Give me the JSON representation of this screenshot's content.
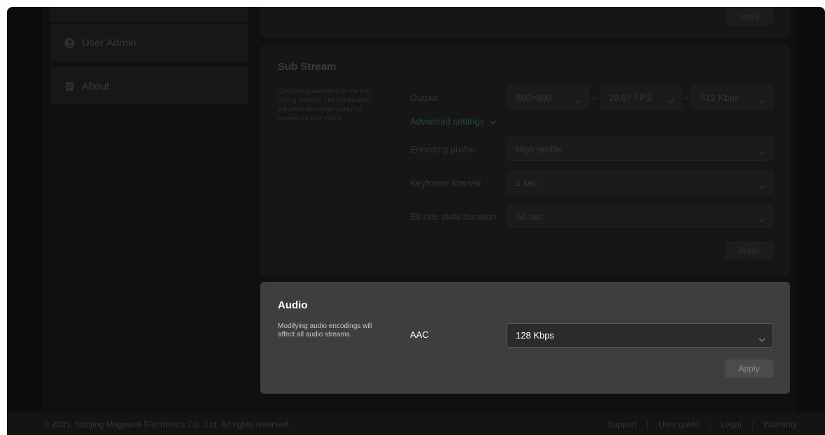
{
  "sidebar": {
    "items": [
      {
        "label": "User Admin",
        "icon": "user-circle-icon"
      },
      {
        "label": "About",
        "icon": "document-icon"
      }
    ]
  },
  "top_panel": {
    "apply_label": "Apply"
  },
  "sub_stream": {
    "title": "Sub Stream",
    "description": "Configure parameters for the sub coding streams. The modification will affect the image quality for preview on your phone.",
    "output_label": "Output",
    "resolution": "800×600",
    "frame_rate": "29.97 FPS",
    "bitrate": "512 Kbps",
    "advanced_settings": "Advanced settings",
    "encoding_profile_label": "Encoding profile",
    "encoding_profile_value": "High profile",
    "keyframe_interval_label": "Keyframe interval",
    "keyframe_interval_value": "1 sec",
    "bitrate_stats_label": "Bit rate stats duration",
    "bitrate_stats_value": "60 sec",
    "apply_label": "Apply"
  },
  "audio": {
    "title": "Audio",
    "description": "Modifying audio encodings will affect all audio streams.",
    "aac_label": "AAC",
    "aac_value": "128 Kbps",
    "apply_label": "Apply"
  },
  "footer": {
    "copyright": "© 2021, Nanjing Magewell Electronics Co., Ltd. All rights reserved.",
    "links": [
      "Support",
      "User guide",
      "Legal",
      "Warranty"
    ]
  },
  "colors": {
    "accent_green": "#1f4d2e",
    "modal_bg": "#3e3e3e",
    "overlay_bg": "#101010"
  }
}
